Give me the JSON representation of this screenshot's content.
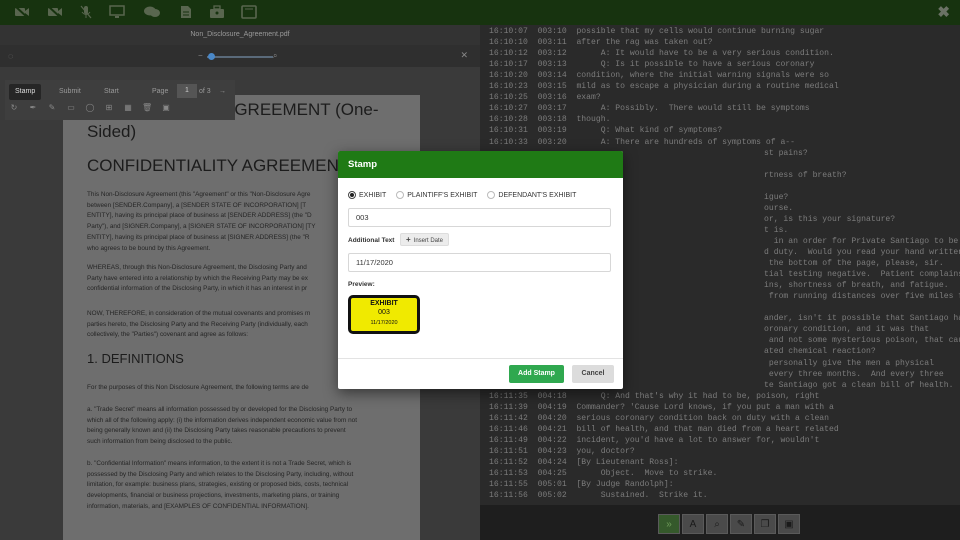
{
  "topbar": {
    "icons": [
      "camera-off-icon",
      "microphone-off-icon",
      "monitor-icon",
      "chat-icon",
      "document-icon",
      "briefcase-icon",
      "tablet-icon"
    ],
    "close": "✖"
  },
  "pdf": {
    "filename": "Non_Disclosure_Agreement.pdf",
    "toolbar": {
      "tabs": [
        "Stamp",
        "Submit",
        "Start"
      ],
      "page_label": "Page",
      "page_value": "1",
      "page_of": "of 3",
      "next": "→"
    }
  },
  "document": {
    "title_line1": "AGREEMENT (One-",
    "title_line2": "Sided)",
    "title2": "CONFIDENTIALITY AGREEMENT",
    "para1": [
      "This Non-Disclosure Agreement (this \"Agreement\" or this \"Non-Disclosure Agre",
      "between [SENDER.Company], a [SENDER STATE OF INCORPORATION] [T",
      "ENTITY], having its principal place of business at [SENDER ADDRESS] (the \"D",
      "Party\"), and [SIGNER.Company], a [SIGNER STATE OF INCORPORATION] [TY",
      "ENTITY], having its principal place of business at [SIGNER ADDRESS] (the \"R",
      "who agrees to be bound by this Agreement."
    ],
    "para2": [
      "WHEREAS, through this Non-Disclosure Agreement, the Disclosing Party and",
      "Party have entered into a relationship by which the Receiving Party may be ex",
      "confidential information of the Disclosing Party, in which it has an interest in pr"
    ],
    "para3": [
      "NOW, THEREFORE, in consideration of the mutual covenants and promises m",
      "parties hereto, the Disclosing Party and the Receiving Party (individually, each",
      "collectively, the \"Parties\") covenant and agree as follows:"
    ],
    "section1": "1. DEFINITIONS",
    "para4": [
      "For the purposes of this Non Disclosure Agreement, the following terms are de"
    ],
    "para5": [
      "a. \"Trade Secret\" means all information possessed by or developed for the Disclosing Party to",
      "which all of the following apply: (i) the information derives independent economic value from not",
      "being generally known and (ii) the Disclosing Party takes reasonable precautions to prevent",
      "such information from being disclosed to the public."
    ],
    "para6": [
      "b. \"Confidential Information\" means information, to the extent it is not a Trade Secret, which is",
      "possessed by the Disclosing Party and which relates to the Disclosing Party, including, without",
      "limitation, for example: business plans, strategies, existing or proposed bids, costs, technical",
      "developments, financial or business projections, investments, marketing plans, or training",
      "information, materials, and [EXAMPLES OF CONFIDENTIAL INFORMATION]."
    ]
  },
  "transcript": [
    [
      "16:10:07",
      "003:10",
      "possible that my cells would continue burning sugar"
    ],
    [
      "16:10:10",
      "003:11",
      "after the rag was taken out?"
    ],
    [
      "16:10:12",
      "003:12",
      "     A: It would have to be a very serious condition."
    ],
    [
      "16:10:17",
      "003:13",
      "     Q: Is it possible to have a serious coronary"
    ],
    [
      "16:10:20",
      "003:14",
      "condition, where the initial warning signals were so"
    ],
    [
      "16:10:23",
      "003:15",
      "mild as to escape a physician during a routine medical"
    ],
    [
      "16:10:25",
      "003:16",
      "exam?"
    ],
    [
      "16:10:27",
      "003:17",
      "     A: Possibly.  There would still be symptoms"
    ],
    [
      "16:10:28",
      "003:18",
      "though."
    ],
    [
      "16:10:31",
      "003:19",
      "     Q: What kind of symptoms?"
    ],
    [
      "16:10:33",
      "003:20",
      "     A: There are hundreds of symptoms of a--"
    ],
    [
      "",
      "",
      "st pains?"
    ],
    [
      "",
      "",
      ""
    ],
    [
      "",
      "",
      "rtness of breath?"
    ],
    [
      "",
      "",
      ""
    ],
    [
      "",
      "",
      "igue?"
    ],
    [
      "",
      "",
      "ourse."
    ],
    [
      "",
      "",
      "or, is this your signature?"
    ],
    [
      "",
      "",
      "t is."
    ],
    [
      "",
      "",
      "  in an order for Private Santiago to be put"
    ],
    [
      "",
      "",
      "d duty.  Would you read your hand written"
    ],
    [
      "",
      "",
      " the bottom of the page, please, sir."
    ],
    [
      "",
      "",
      "tial testing negative.  Patient complains"
    ],
    [
      "",
      "",
      "ins, shortness of breath, and fatigue."
    ],
    [
      "",
      "",
      " from running distances over five miles for"
    ],
    [
      "",
      "",
      ""
    ],
    [
      "",
      "",
      "ander, isn't it possible that Santiago had"
    ],
    [
      "",
      "",
      "oronary condition, and it was that"
    ],
    [
      "",
      "",
      " and not some mysterious poison, that caused"
    ],
    [
      "",
      "",
      "ated chemical reaction?"
    ],
    [
      "",
      "",
      " personally give the men a physical"
    ],
    [
      "",
      "",
      " every three months.  And every three"
    ],
    [
      "",
      "",
      "te Santiago got a clean bill of health."
    ],
    [
      "16:11:35",
      "004:18",
      "     Q: And that's why it had to be, poison, right"
    ],
    [
      "16:11:39",
      "004:19",
      "Commander? 'Cause Lord knows, if you put a man with a"
    ],
    [
      "16:11:42",
      "004:20",
      "serious coronary condition back on duty with a clean"
    ],
    [
      "16:11:46",
      "004:21",
      "bill of health, and that man died from a heart related"
    ],
    [
      "16:11:49",
      "004:22",
      "incident, you'd have a lot to answer for, wouldn't"
    ],
    [
      "16:11:51",
      "004:23",
      "you, doctor?"
    ],
    [
      "16:11:52",
      "004:24",
      "[By Lieutenant Ross]:"
    ],
    [
      "16:11:53",
      "004:25",
      "     Object.  Move to strike."
    ],
    [
      "16:11:55",
      "005:01",
      "[By Judge Randolph]:"
    ],
    [
      "16:11:56",
      "005:02",
      "     Sustained.  Strike it."
    ]
  ],
  "bottom_tools": [
    "scroll-icon",
    "font-icon",
    "search-icon",
    "edit-icon",
    "copy-icon",
    "save-icon"
  ],
  "bottom_glyphs": [
    "»",
    "A",
    "⌕",
    "✎",
    "❐",
    "▣"
  ],
  "stamp_modal": {
    "title": "Stamp",
    "options": [
      "EXHIBIT",
      "PLAINTIFF'S EXHIBIT",
      "DEFENDANT'S EXHIBIT"
    ],
    "selected": "EXHIBIT",
    "number_value": "003",
    "additional_text_label": "Additional Text",
    "insert_date_label": "Insert Date",
    "additional_text_value": "11/17/2020",
    "preview_label": "Preview:",
    "preview": {
      "title": "EXHIBIT",
      "number": "003",
      "date": "11/17/2020"
    },
    "add_button": "Add Stamp",
    "cancel_button": "Cancel"
  }
}
